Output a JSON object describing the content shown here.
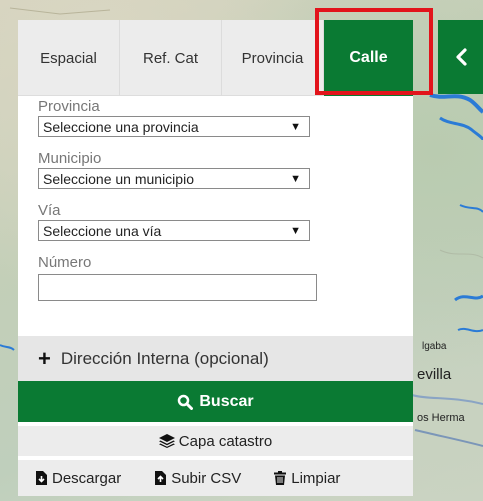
{
  "tabs": [
    {
      "label": "Espacial"
    },
    {
      "label": "Ref. Cat"
    },
    {
      "label": "Provincia"
    },
    {
      "label": "Calle"
    }
  ],
  "active_tab": "Calle",
  "form": {
    "provincia": {
      "label": "Provincia",
      "value": "Seleccione una provincia"
    },
    "municipio": {
      "label": "Municipio",
      "value": "Seleccione un municipio"
    },
    "via": {
      "label": "Vía",
      "value": "Seleccione una vía"
    },
    "numero": {
      "label": "Número",
      "value": ""
    }
  },
  "actions": {
    "direccion_interna": "Dirección Interna (opcional)",
    "buscar": "Buscar",
    "capa_catastro": "Capa catastro",
    "descargar": "Descargar",
    "subir_csv": "Subir CSV",
    "limpiar": "Limpiar"
  },
  "map_labels": {
    "l1": "lgaba",
    "l2": "evilla",
    "l3": "os Herma"
  },
  "colors": {
    "accent": "#0a7a33",
    "highlight": "#e2141b",
    "water": "#2b7bd6"
  }
}
